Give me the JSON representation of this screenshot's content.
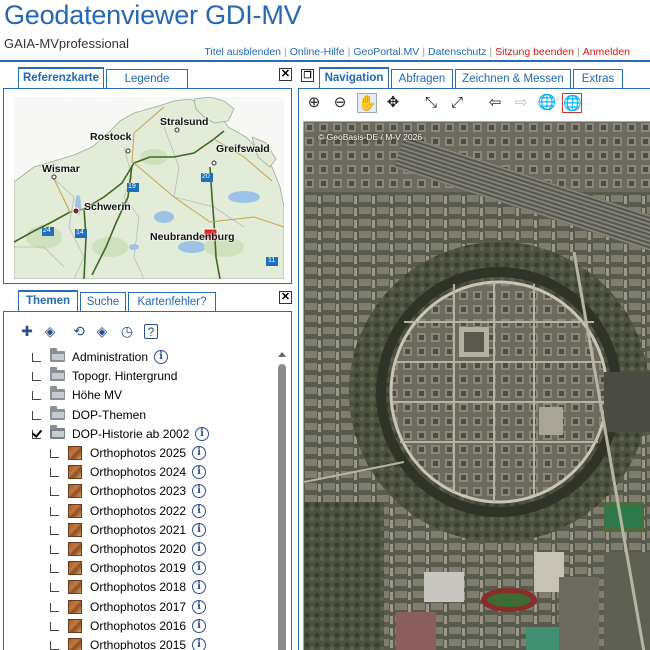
{
  "app": {
    "title": "Geodatenviewer GDI-MV",
    "subtitle": "GAIA-MVprofessional"
  },
  "header_links": [
    {
      "label": "Titel ausblenden",
      "color": "blue"
    },
    {
      "label": "Online-Hilfe",
      "color": "blue"
    },
    {
      "label": "GeoPortal.MV",
      "color": "blue"
    },
    {
      "label": "Datenschutz",
      "color": "blue"
    },
    {
      "label": "Sitzung beenden",
      "color": "red"
    },
    {
      "label": "Anmelden",
      "color": "red"
    }
  ],
  "ref_tabs": [
    {
      "label": "Referenzkarte",
      "active": true
    },
    {
      "label": "Legende",
      "active": false
    }
  ],
  "ref_map": {
    "cities": [
      "Stralsund",
      "Rostock",
      "Greifswald",
      "Wismar",
      "Schwerin",
      "Neubrandenburg"
    ],
    "road_shields": [
      "19",
      "20",
      "24",
      "14",
      "11"
    ]
  },
  "theme_tabs": [
    {
      "label": "Themen",
      "active": true
    },
    {
      "label": "Suche",
      "active": false
    },
    {
      "label": "Kartenfehler?",
      "active": false
    }
  ],
  "theme_toolbar_icons": [
    "add-layer-icon",
    "layers-icon",
    "refresh-icon",
    "layers-stack-icon",
    "clock-icon",
    "help-icon"
  ],
  "layers": [
    {
      "label": "Administration",
      "icon": "folder",
      "checked": false,
      "info": true,
      "indent": 0
    },
    {
      "label": "Topogr. Hintergrund",
      "icon": "folder",
      "checked": false,
      "info": false,
      "indent": 0
    },
    {
      "label": "Höhe MV",
      "icon": "folder",
      "checked": false,
      "info": false,
      "indent": 0
    },
    {
      "label": "DOP-Themen",
      "icon": "folder",
      "checked": false,
      "info": false,
      "indent": 0
    },
    {
      "label": "DOP-Historie ab 2002",
      "icon": "folder-open",
      "checked": true,
      "info": true,
      "indent": 0
    },
    {
      "label": "Orthophotos 2025",
      "icon": "ortho",
      "checked": false,
      "info": true,
      "indent": 1
    },
    {
      "label": "Orthophotos 2024",
      "icon": "ortho",
      "checked": false,
      "info": true,
      "indent": 1
    },
    {
      "label": "Orthophotos 2023",
      "icon": "ortho",
      "checked": false,
      "info": true,
      "indent": 1
    },
    {
      "label": "Orthophotos 2022",
      "icon": "ortho",
      "checked": false,
      "info": true,
      "indent": 1
    },
    {
      "label": "Orthophotos 2021",
      "icon": "ortho",
      "checked": false,
      "info": true,
      "indent": 1
    },
    {
      "label": "Orthophotos 2020",
      "icon": "ortho",
      "checked": false,
      "info": true,
      "indent": 1
    },
    {
      "label": "Orthophotos 2019",
      "icon": "ortho",
      "checked": false,
      "info": true,
      "indent": 1
    },
    {
      "label": "Orthophotos 2018",
      "icon": "ortho",
      "checked": false,
      "info": true,
      "indent": 1
    },
    {
      "label": "Orthophotos 2017",
      "icon": "ortho",
      "checked": false,
      "info": true,
      "indent": 1
    },
    {
      "label": "Orthophotos 2016",
      "icon": "ortho",
      "checked": false,
      "info": true,
      "indent": 1
    },
    {
      "label": "Orthophotos 2015",
      "icon": "ortho",
      "checked": false,
      "info": true,
      "indent": 1
    }
  ],
  "map_tabs": [
    {
      "label": "Navigation",
      "active": true
    },
    {
      "label": "Abfragen",
      "active": false
    },
    {
      "label": "Zeichnen & Messen",
      "active": false
    },
    {
      "label": "Extras",
      "active": false
    }
  ],
  "map_tools": [
    {
      "name": "zoom-in-icon",
      "glyph": "⊕",
      "state": "normal"
    },
    {
      "name": "zoom-out-icon",
      "glyph": "⊖",
      "state": "normal"
    },
    {
      "name": "pan-hand-icon",
      "glyph": "✋",
      "state": "active"
    },
    {
      "name": "move-icon",
      "glyph": "✥",
      "state": "normal"
    },
    {
      "name": "zoom-to-extent-in-icon",
      "glyph": "⤡",
      "state": "normal"
    },
    {
      "name": "zoom-to-extent-out-icon",
      "glyph": "⤢",
      "state": "normal"
    },
    {
      "name": "back-arrow-icon",
      "glyph": "⇦",
      "state": "normal"
    },
    {
      "name": "forward-arrow-icon",
      "glyph": "⇨",
      "state": "disabled"
    },
    {
      "name": "globe-icon",
      "glyph": "🌐",
      "state": "normal"
    },
    {
      "name": "globe-select-icon",
      "glyph": "🌐",
      "state": "normal"
    }
  ],
  "map": {
    "copyright": "© GeoBasis-DE / M-V 2026"
  },
  "colors": {
    "accent": "#2368b1",
    "link_red": "#d2191c"
  }
}
